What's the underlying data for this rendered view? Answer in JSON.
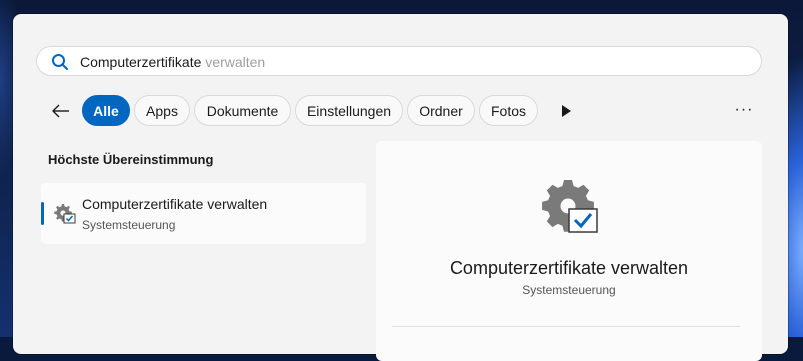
{
  "search": {
    "typed_text": "Computerzertifikate",
    "suggestion_text": " verwalten",
    "icon": "search-icon"
  },
  "filters": {
    "back_icon": "arrow-left-icon",
    "items": [
      {
        "label": "Alle",
        "active": true
      },
      {
        "label": "Apps",
        "active": false
      },
      {
        "label": "Dokumente",
        "active": false
      },
      {
        "label": "Einstellungen",
        "active": false
      },
      {
        "label": "Ordner",
        "active": false
      },
      {
        "label": "Fotos",
        "active": false
      }
    ],
    "more_icon": "play-icon",
    "overflow_label": "···"
  },
  "best_match": {
    "section_title": "Höchste Übereinstimmung",
    "title": "Computerzertifikate verwalten",
    "subtitle": "Systemsteuerung",
    "icon": "certificate-gear-icon"
  },
  "detail": {
    "title": "Computerzertifikate verwalten",
    "subtitle": "Systemsteuerung",
    "icon": "certificate-gear-icon"
  },
  "colors": {
    "accent": "#0067c0",
    "panel_bg": "#f3f3f3",
    "gear": "#7a7a7a"
  }
}
